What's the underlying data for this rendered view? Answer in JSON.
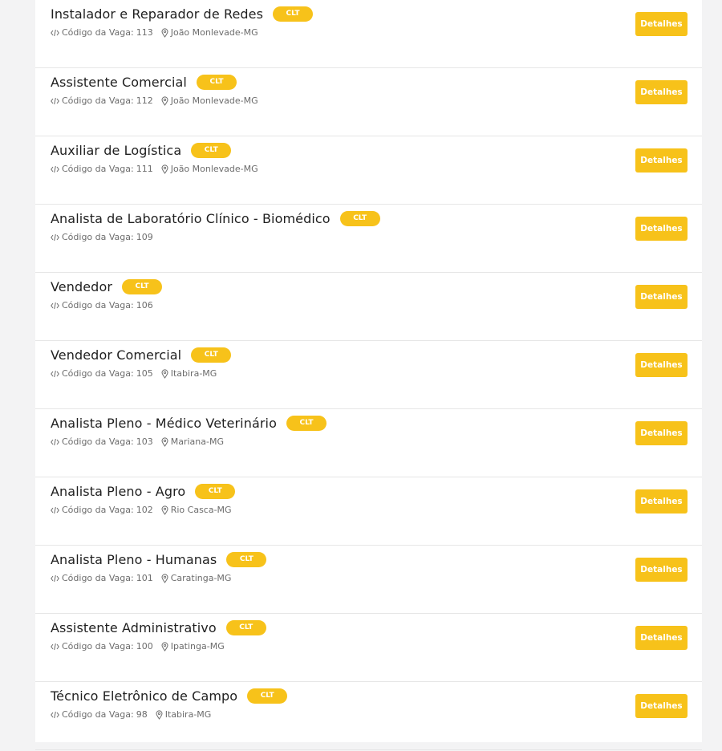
{
  "theme": {
    "accent": "#f7c21a",
    "background": "#f3f3f4",
    "card": "#ffffff"
  },
  "code_label": "Código da Vaga:",
  "details_label": "Detalhes",
  "icons": {
    "code": "code-icon",
    "location": "map-pin-icon"
  },
  "jobs": [
    {
      "title": "Instalador e Reparador de Redes",
      "badge": "CLT",
      "code": "113",
      "location": "João Monlevade-MG"
    },
    {
      "title": "Assistente Comercial",
      "badge": "CLT",
      "code": "112",
      "location": "João Monlevade-MG"
    },
    {
      "title": "Auxiliar de Logística",
      "badge": "CLT",
      "code": "111",
      "location": "João Monlevade-MG"
    },
    {
      "title": "Analista de Laboratório Clínico - Biomédico",
      "badge": "CLT",
      "code": "109",
      "location": ""
    },
    {
      "title": "Vendedor",
      "badge": "CLT",
      "code": "106",
      "location": ""
    },
    {
      "title": "Vendedor Comercial",
      "badge": "CLT",
      "code": "105",
      "location": "Itabira-MG"
    },
    {
      "title": "Analista Pleno - Médico Veterinário",
      "badge": "CLT",
      "code": "103",
      "location": "Mariana-MG"
    },
    {
      "title": "Analista Pleno - Agro",
      "badge": "CLT",
      "code": "102",
      "location": "Rio Casca-MG"
    },
    {
      "title": "Analista Pleno - Humanas",
      "badge": "CLT",
      "code": "101",
      "location": "Caratinga-MG"
    },
    {
      "title": "Assistente Administrativo",
      "badge": "CLT",
      "code": "100",
      "location": "Ipatinga-MG"
    },
    {
      "title": "Técnico Eletrônico de Campo",
      "badge": "CLT",
      "code": "98",
      "location": "Itabira-MG"
    }
  ]
}
